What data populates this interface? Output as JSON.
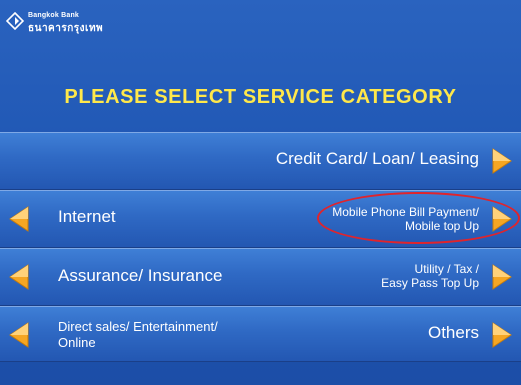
{
  "brand": {
    "name_en": "Bangkok Bank",
    "name_th": "ธนาคารกรุงเทพ",
    "logo_icon": "bank-logo-icon"
  },
  "heading": "PLEASE SELECT SERVICE CATEGORY",
  "options": {
    "credit_card": "Credit Card/ Loan/ Leasing",
    "internet": "Internet",
    "mobile_line1": "Mobile Phone Bill Payment/",
    "mobile_line2": "Mobile top Up",
    "assurance": "Assurance/ Insurance",
    "utility_line1": "Utility / Tax /",
    "utility_line2": "Easy Pass Top Up",
    "direct_line1": "Direct sales/ Entertainment/",
    "direct_line2": "Online",
    "others": "Others"
  },
  "colors": {
    "heading": "#ffe84a",
    "background": "#1f56b3",
    "arrow": "#f5a623",
    "highlight_circle": "#e0242c"
  }
}
